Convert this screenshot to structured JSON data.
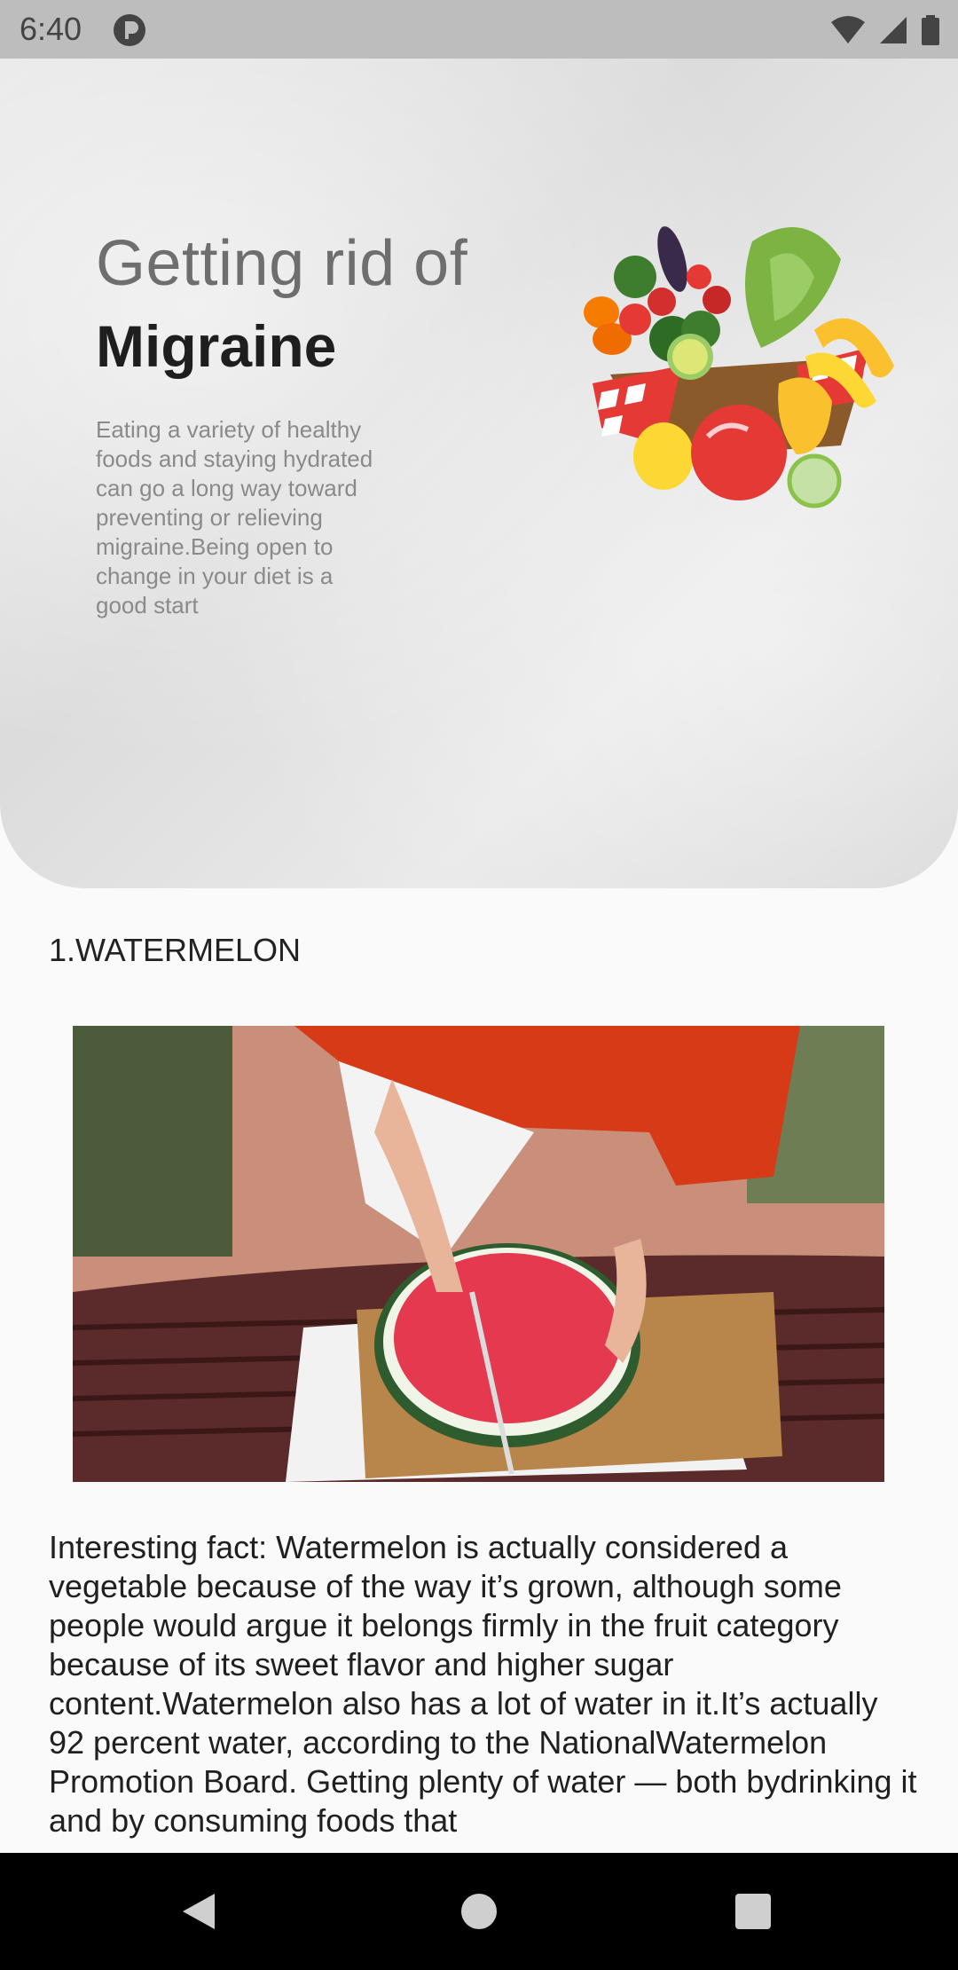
{
  "status_bar": {
    "time": "6:40",
    "icons": [
      "app-notification-icon",
      "wifi-icon",
      "signal-icon",
      "battery-icon"
    ]
  },
  "hero": {
    "title_light": "Getting rid of",
    "title_bold": "Migraine",
    "description": "Eating a variety of healthy foods and staying hydrated can go a long way toward preventing or relieving migraine.Being open to change in your diet is a good start",
    "image": "fruit-basket-image"
  },
  "section": {
    "title": "1.WATERMELON",
    "image": "watermelon-cutting-photo",
    "fact": "Interesting fact: Watermelon is actually considered a vegetable because of the way it’s grown, although some people would argue it belongs firmly in the fruit category because of its sweet flavor and higher sugar content.Watermelon also has a lot of water in it.It’s actually 92 percent water, according to the NationalWatermelon Promotion Board. Getting plenty of water — both bydrinking it and by consuming foods that"
  },
  "nav_bar": {
    "icons": [
      "back-icon",
      "home-icon",
      "recents-icon"
    ]
  }
}
